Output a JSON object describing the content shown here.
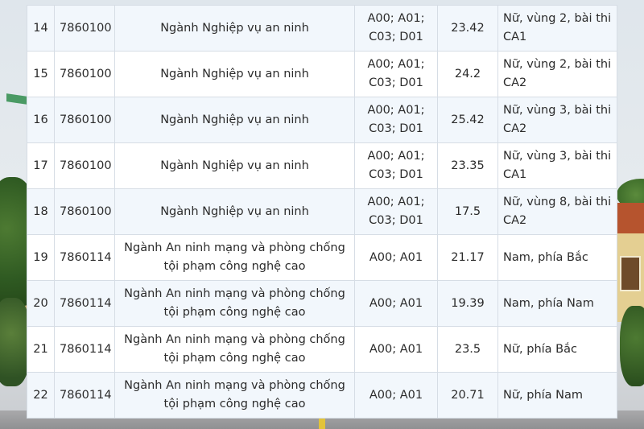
{
  "table": {
    "rows": [
      {
        "stt": "14",
        "code": "7860100",
        "name": "Ngành Nghiệp vụ an ninh",
        "combo": "A00; A01; C03; D01",
        "score": "23.42",
        "note": "Nữ, vùng 2, bài thi CA1"
      },
      {
        "stt": "15",
        "code": "7860100",
        "name": "Ngành Nghiệp vụ an ninh",
        "combo": "A00; A01; C03; D01",
        "score": "24.2",
        "note": "Nữ, vùng 2, bài thi CA2"
      },
      {
        "stt": "16",
        "code": "7860100",
        "name": "Ngành Nghiệp vụ an ninh",
        "combo": "A00; A01; C03; D01",
        "score": "25.42",
        "note": "Nữ, vùng 3, bài thi CA2"
      },
      {
        "stt": "17",
        "code": "7860100",
        "name": "Ngành Nghiệp vụ an ninh",
        "combo": "A00; A01; C03; D01",
        "score": "23.35",
        "note": "Nữ, vùng 3, bài thi CA1"
      },
      {
        "stt": "18",
        "code": "7860100",
        "name": "Ngành Nghiệp vụ an ninh",
        "combo": "A00; A01; C03; D01",
        "score": "17.5",
        "note": "Nữ, vùng 8, bài thi CA2"
      },
      {
        "stt": "19",
        "code": "7860114",
        "name": "Ngành An ninh mạng và phòng chống tội phạm công nghệ cao",
        "combo": "A00; A01",
        "score": "21.17",
        "note": "Nam, phía Bắc"
      },
      {
        "stt": "20",
        "code": "7860114",
        "name": "Ngành An ninh mạng và phòng chống tội phạm công nghệ cao",
        "combo": "A00; A01",
        "score": "19.39",
        "note": "Nam, phía Nam"
      },
      {
        "stt": "21",
        "code": "7860114",
        "name": "Ngành An ninh mạng và phòng chống tội phạm công nghệ cao",
        "combo": "A00; A01",
        "score": "23.5",
        "note": "Nữ, phía Bắc"
      },
      {
        "stt": "22",
        "code": "7860114",
        "name": "Ngành An ninh mạng và phòng chống tội phạm công nghệ cao",
        "combo": "A00; A01",
        "score": "20.71",
        "note": "Nữ, phía Nam"
      }
    ]
  }
}
